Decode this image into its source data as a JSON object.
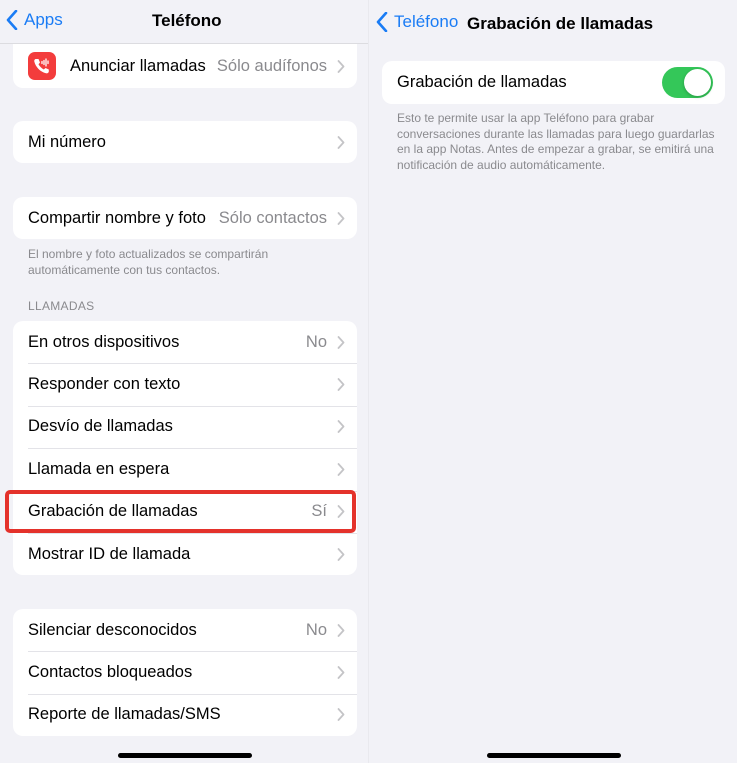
{
  "left": {
    "back_label": "Apps",
    "title": "Teléfono",
    "announce": {
      "label": "Anunciar llamadas",
      "value": "Sólo audífonos"
    },
    "my_number": {
      "label": "Mi número"
    },
    "share": {
      "label": "Compartir nombre y foto",
      "value": "Sólo contactos",
      "footnote": "El nombre y foto actualizados se compartirán automáticamente con tus contactos."
    },
    "calls_header": "LLAMADAS",
    "calls": [
      {
        "label": "En otros dispositivos",
        "value": "No"
      },
      {
        "label": "Responder con texto",
        "value": ""
      },
      {
        "label": "Desvío de llamadas",
        "value": ""
      },
      {
        "label": "Llamada en espera",
        "value": ""
      },
      {
        "label": "Grabación de llamadas",
        "value": "Sí"
      },
      {
        "label": "Mostrar ID de llamada",
        "value": ""
      }
    ],
    "blocking": [
      {
        "label": "Silenciar desconocidos",
        "value": "No"
      },
      {
        "label": "Contactos bloqueados",
        "value": ""
      },
      {
        "label": "Reporte de llamadas/SMS",
        "value": ""
      }
    ]
  },
  "right": {
    "back_label": "Teléfono",
    "title": "Grabación de llamadas",
    "toggle_label": "Grabación de llamadas",
    "toggle_on": true,
    "description": "Esto te permite usar la app Teléfono para grabar conversaciones durante las llamadas para luego guardarlas en la app Notas. Antes de empezar a grabar, se emitirá una notificación de audio automáticamente."
  },
  "colors": {
    "accent": "#1a7cf5",
    "toggle_on": "#34c759",
    "icon_bg": "#f33c3c",
    "highlight": "#e4322b"
  },
  "icons": {
    "back": "chevron-left-icon",
    "row": "chevron-right-icon",
    "announce": "phone-waves-icon"
  }
}
